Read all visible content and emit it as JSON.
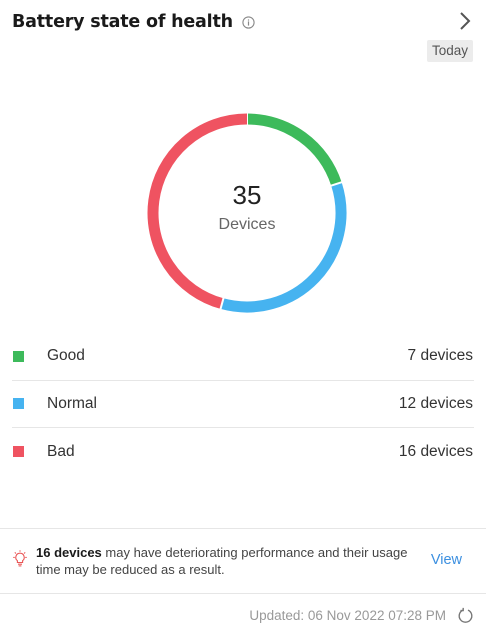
{
  "card": {
    "title": "Battery state of health",
    "period": "Today"
  },
  "summary": {
    "total": "35",
    "unit": "Devices"
  },
  "legend": [
    {
      "label": "Good",
      "count": 7,
      "value_text": "7 devices",
      "color": "#3dba5b"
    },
    {
      "label": "Normal",
      "count": 12,
      "value_text": "12 devices",
      "color": "#46b3f0"
    },
    {
      "label": "Bad",
      "count": 16,
      "value_text": "16 devices",
      "color": "#ef5361"
    }
  ],
  "notice": {
    "highlight": "16 devices",
    "text": " may have deteriorating performance and their usage time may be reduced as a result.",
    "action": "View"
  },
  "footer": {
    "updated": "Updated: 06 Nov 2022 07:28 PM"
  },
  "colors": {
    "link": "#3b8fe0",
    "bulb": "#e95656"
  },
  "icons": {
    "info": "info-icon",
    "chevron": "chevron-right-icon",
    "bulb": "lightbulb-icon",
    "refresh": "refresh-icon"
  }
}
